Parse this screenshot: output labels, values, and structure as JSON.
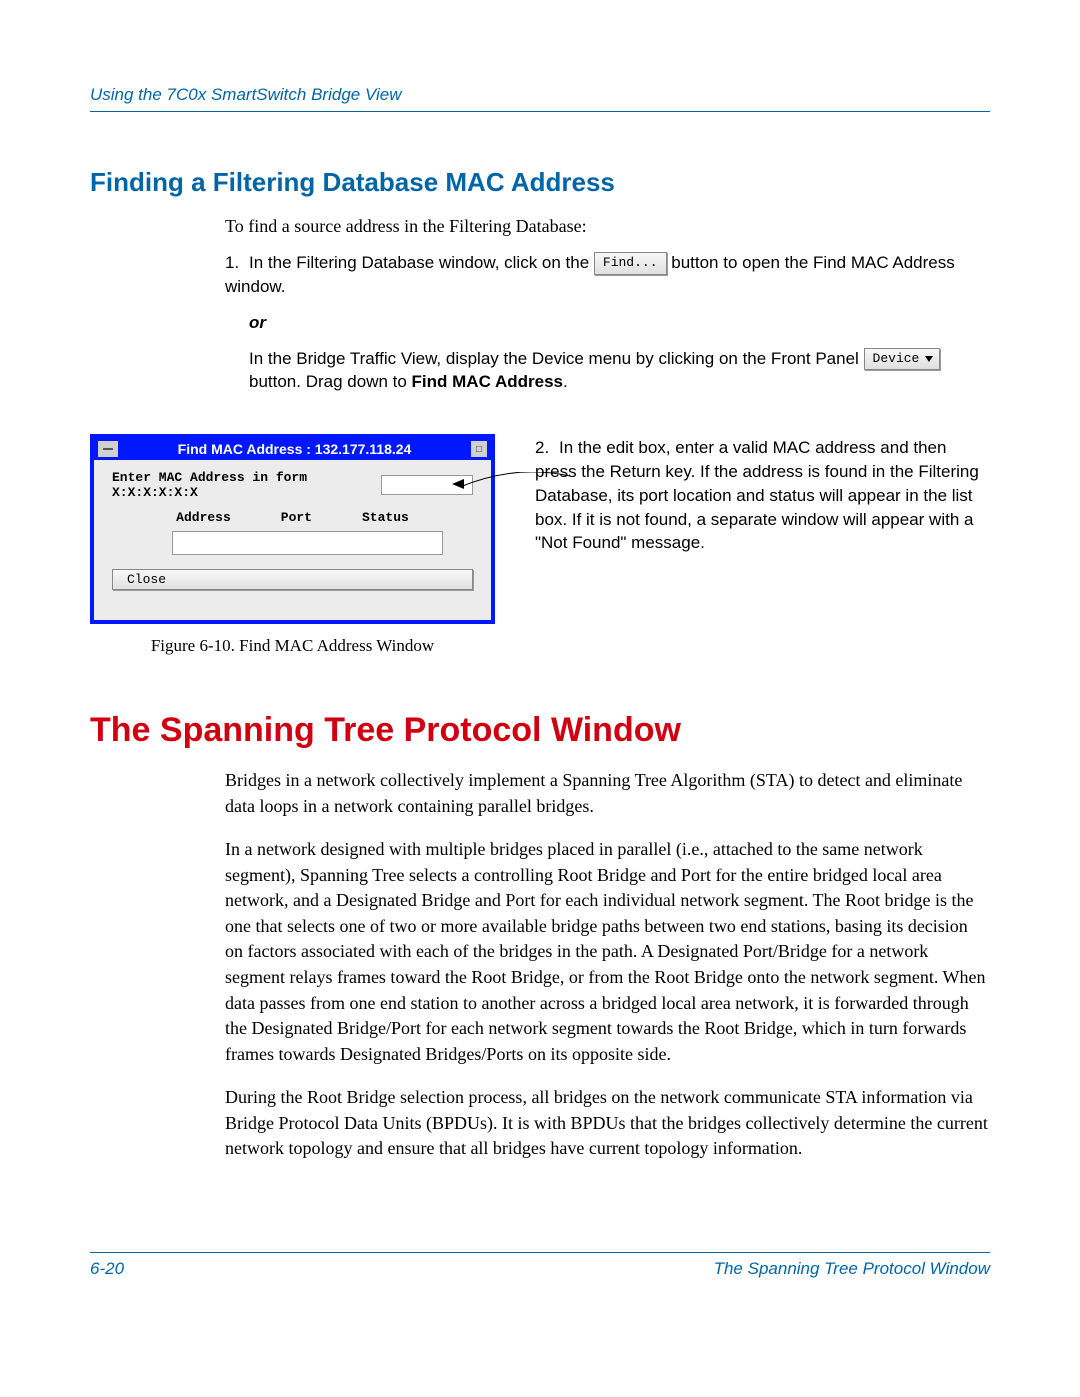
{
  "header": {
    "left": "Using the 7C0x SmartSwitch Bridge View"
  },
  "section1": {
    "heading": "Finding a Filtering Database MAC Address",
    "intro": "To find a source address in the Filtering Database:",
    "step1_num": "1.",
    "step1_a": "In the Filtering Database window, click on the ",
    "step1_btn": "Find...",
    "step1_b": " button to open the Find MAC Address window.",
    "or": "or",
    "step1_alt_a": "In the Bridge Traffic View, display the Device menu by clicking on the Front Panel ",
    "step1_alt_device": "Device",
    "step1_alt_b": " button. Drag down to ",
    "step1_alt_bold": "Find MAC Address",
    "step1_alt_c": "."
  },
  "figure": {
    "title": "Find MAC Address : 132.177.118.24",
    "prompt": "Enter MAC Address in form X:X:X:X:X:X",
    "col_address": "Address",
    "col_port": "Port",
    "col_status": "Status",
    "close": "Close",
    "caption": "Figure 6-10. Find MAC Address Window",
    "sysmenu_glyph": "□"
  },
  "step2": {
    "num": "2.",
    "text": "In the edit box, enter a valid MAC address and then press the Return key. If the address is found in the Filtering Database, its port location and status will appear in the list box. If it is not found, a separate window will appear with a \"Not Found\" message."
  },
  "section2": {
    "heading": "The Spanning Tree Protocol Window",
    "p1": "Bridges in a network collectively implement a Spanning Tree Algorithm (STA) to detect and eliminate data loops in a network containing parallel bridges.",
    "p2": "In a network designed with multiple bridges placed in parallel (i.e., attached to the same network segment), Spanning Tree selects a controlling Root Bridge and Port for the entire bridged local area network, and a Designated Bridge and Port for each individual network segment. The Root bridge is the one that selects one of two or more available bridge paths between two end stations, basing its decision on factors associated with each of the bridges in the path. A Designated Port/Bridge for a network segment relays frames toward the Root Bridge, or from the Root Bridge onto the network segment. When data passes from one end station to another across a bridged local area network, it is forwarded through the Designated Bridge/Port for each network segment towards the Root Bridge, which in turn forwards frames towards Designated Bridges/Ports on its opposite side.",
    "p3": "During the Root Bridge selection process, all bridges on the network communicate STA information via Bridge Protocol Data Units (BPDUs). It is with BPDUs that the bridges collectively determine the current network topology and ensure that all bridges have current topology information."
  },
  "footer": {
    "left": "6-20",
    "right": "The Spanning Tree Protocol Window"
  }
}
